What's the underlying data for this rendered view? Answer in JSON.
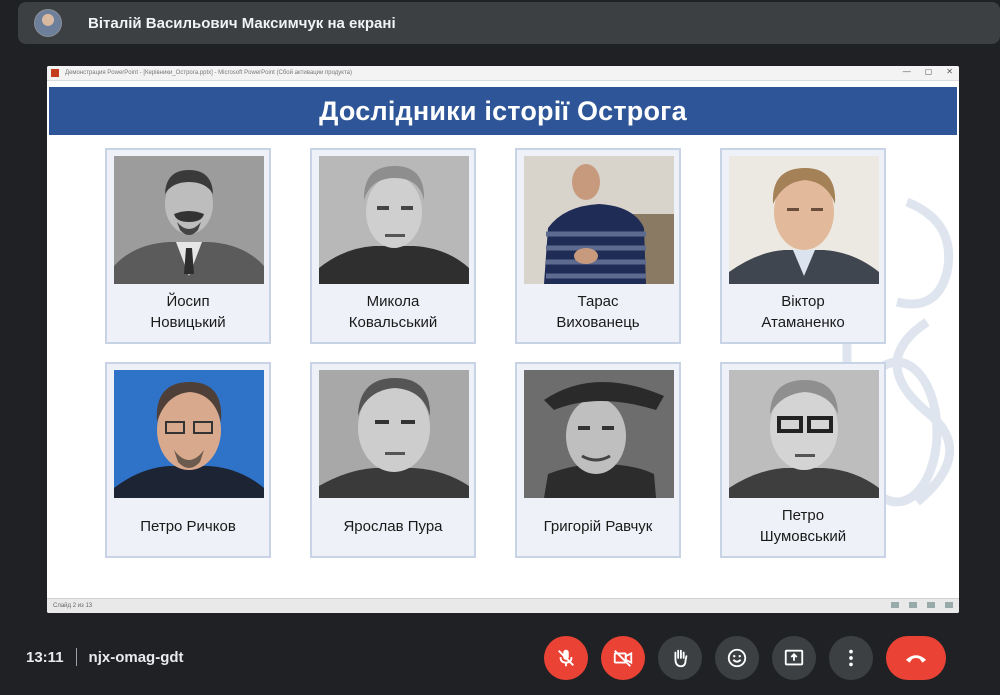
{
  "presenter": {
    "banner_text": "Віталій Васильович Максимчук на екрані"
  },
  "window": {
    "title": "Демонстрация PowerPoint - [Керівники_Острога.pptx] - Microsoft PowerPoint (Сбой активации продукта)",
    "status_left": "Слайд 2 из 13"
  },
  "slide": {
    "title": "Дослідники історії Острога",
    "people": [
      {
        "name": "Йосип\nНовицький",
        "photo_icon": "portrait-bw-mustache"
      },
      {
        "name": "Микола\nКовальський",
        "photo_icon": "portrait-bw-gray-hair"
      },
      {
        "name": "Тарас\nВихованець",
        "photo_icon": "portrait-color-striped-sweater"
      },
      {
        "name": "Віктор\nАтаманенко",
        "photo_icon": "portrait-color-suit"
      },
      {
        "name": "Петро Ричков",
        "photo_icon": "portrait-color-glasses-blue-bg"
      },
      {
        "name": "Ярослав Пура",
        "photo_icon": "portrait-bw"
      },
      {
        "name": "Григорій Равчук",
        "photo_icon": "portrait-bw-cap"
      },
      {
        "name": "Петро\nШумовський",
        "photo_icon": "portrait-bw-glasses"
      }
    ]
  },
  "meeting": {
    "time": "13:11",
    "code": "njx-omag-gdt",
    "controls": [
      {
        "name": "mic-off-icon",
        "color": "#ea4335"
      },
      {
        "name": "camera-off-icon",
        "color": "#ea4335"
      },
      {
        "name": "raise-hand-icon",
        "color": "#3c4043"
      },
      {
        "name": "emoji-icon",
        "color": "#3c4043"
      },
      {
        "name": "present-screen-icon",
        "color": "#3c4043"
      },
      {
        "name": "more-options-icon",
        "color": "#3c4043"
      },
      {
        "name": "end-call-icon",
        "color": "#ea4335"
      }
    ]
  }
}
